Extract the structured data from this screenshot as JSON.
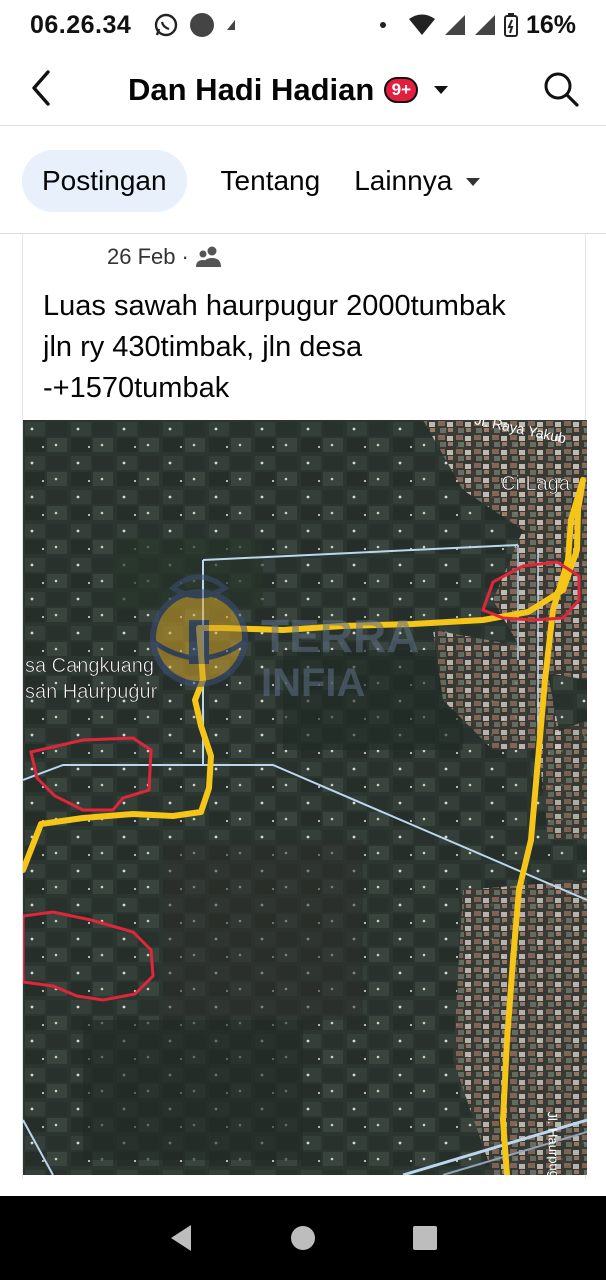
{
  "status_bar": {
    "time": "06.26.34",
    "battery": "16%",
    "icons": [
      "whatsapp-icon",
      "circle-notification-icon",
      "small-notification-icon",
      "wifi-icon",
      "signal-icon",
      "signal-icon",
      "battery-icon"
    ]
  },
  "header": {
    "title": "Dan Hadi Hadian",
    "badge": "9+",
    "icons": {
      "back": "back-arrow-icon",
      "search": "search-icon",
      "dropdown": "caret-down-icon"
    }
  },
  "tabs": [
    {
      "label": "Postingan",
      "active": true
    },
    {
      "label": "Tentang",
      "active": false
    },
    {
      "label": "Lainnya",
      "active": false,
      "has_dropdown": true
    }
  ],
  "post": {
    "date": "26 Feb",
    "separator": "·",
    "audience_icon": "friends-icon",
    "text_lines": [
      "Luas sawah haurpugur 2000tumbak",
      "jln ry 430timbak, jln desa",
      "-+1570tumbak"
    ],
    "map_labels": {
      "top_right": "Ci Laga",
      "top_road": "Jl. Raya Yakub",
      "left_line1": "sa Cangkuang",
      "left_line2": "san Haurpugur",
      "bottom_road": "Jl. Haurpugur",
      "watermark_top": "TERRA",
      "watermark_bottom": "INFIA"
    },
    "colors": {
      "route": "#f5c518",
      "outline": "#e0263a",
      "road": "#bcd6ee"
    }
  },
  "nav_bar": {
    "buttons": [
      "back-triangle-icon",
      "home-circle-icon",
      "recents-square-icon"
    ]
  }
}
